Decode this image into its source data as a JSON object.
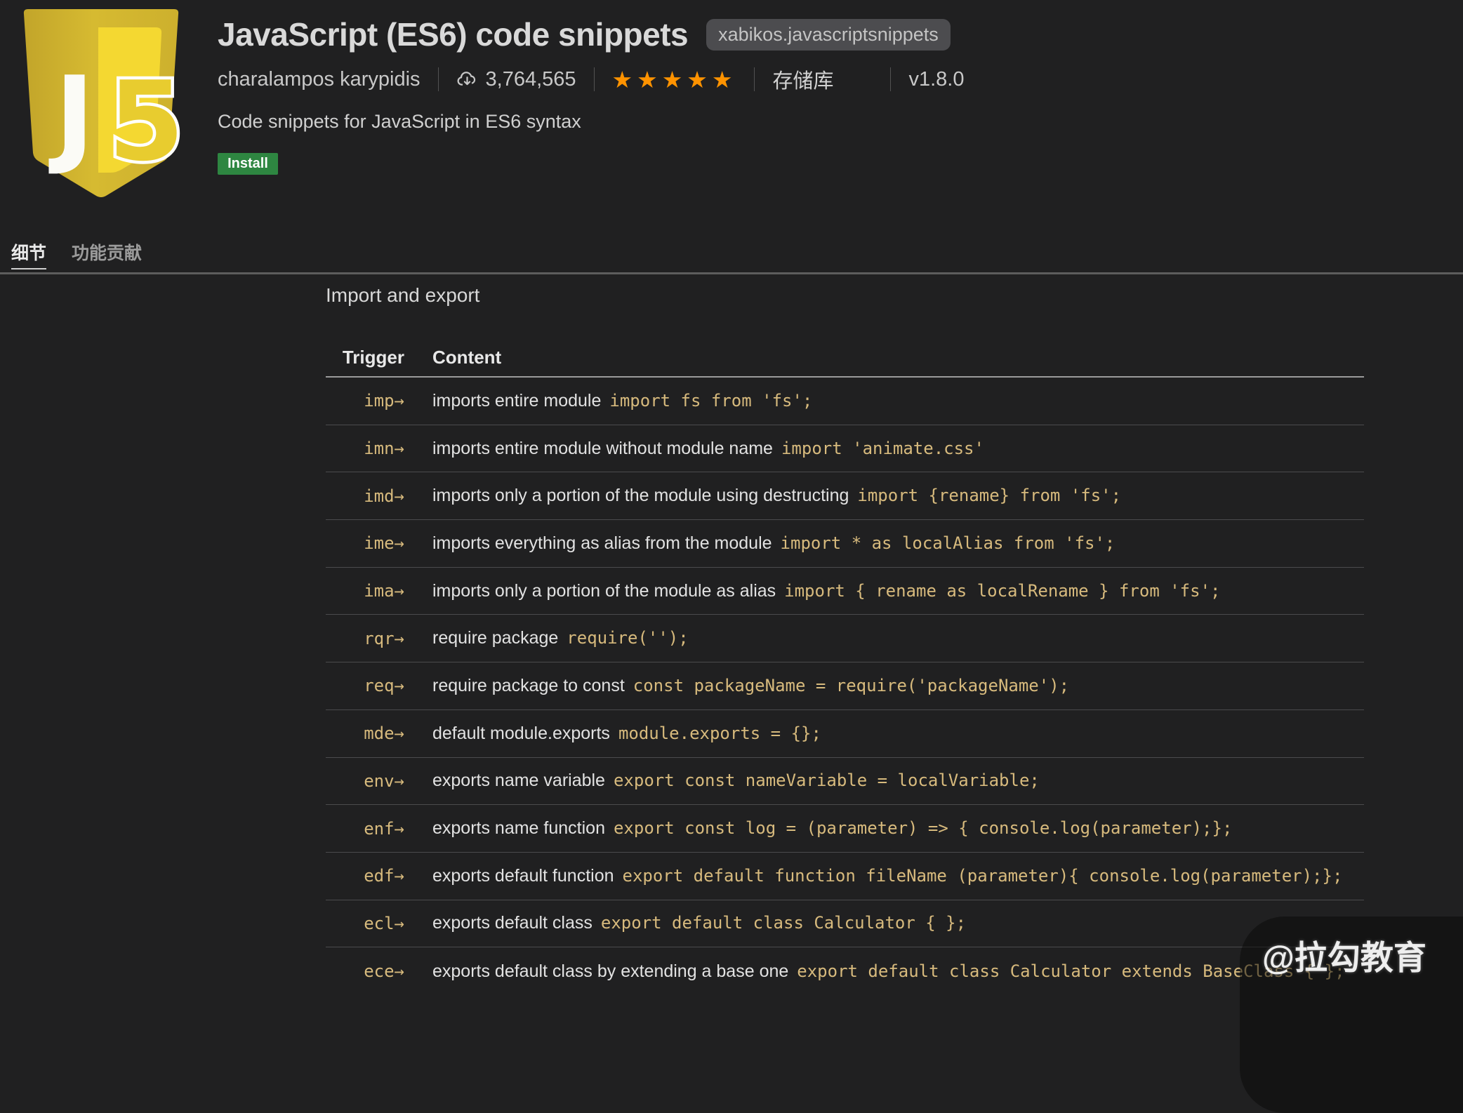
{
  "colors": {
    "page_bg": "#202021",
    "code_gold": "#d7ba7d",
    "star_orange": "#ff9300",
    "install_green": "#2e8641",
    "badge_bg": "#4c4c4f",
    "row_divider": "#4b4b4d",
    "header_underline": "#9b9b9b"
  },
  "header": {
    "title": "JavaScript (ES6) code snippets",
    "extension_id": "xabikos.javascriptsnippets",
    "publisher": "charalampos karypidis",
    "installs": "3,764,565",
    "rating_stars": "★★★★★",
    "repository_label": "存储库",
    "version": "v1.8.0",
    "description": "Code snippets for JavaScript in ES6 syntax",
    "install_label": "Install"
  },
  "tabs": [
    {
      "label": "细节"
    },
    {
      "label": "功能贡献"
    }
  ],
  "section": {
    "title": "Import and export",
    "table": {
      "columns": [
        "Trigger",
        "Content"
      ],
      "rows": [
        {
          "trigger": "imp→",
          "description": "imports entire module",
          "code": "import fs from 'fs';"
        },
        {
          "trigger": "imn→",
          "description": "imports entire module without module name",
          "code": "import 'animate.css'"
        },
        {
          "trigger": "imd→",
          "description": "imports only a portion of the module using destructing",
          "code": "import {rename} from 'fs';"
        },
        {
          "trigger": "ime→",
          "description": "imports everything as alias from the module",
          "code": "import * as localAlias from 'fs';"
        },
        {
          "trigger": "ima→",
          "description": "imports only a portion of the module as alias",
          "code": "import { rename as localRename } from 'fs';"
        },
        {
          "trigger": "rqr→",
          "description": "require package",
          "code": "require('');"
        },
        {
          "trigger": "req→",
          "description": "require package to const",
          "code": "const packageName = require('packageName');"
        },
        {
          "trigger": "mde→",
          "description": "default module.exports",
          "code": "module.exports = {};"
        },
        {
          "trigger": "env→",
          "description": "exports name variable",
          "code": "export const nameVariable = localVariable;"
        },
        {
          "trigger": "enf→",
          "description": "exports name function",
          "code": "export const log = (parameter) => { console.log(parameter);};"
        },
        {
          "trigger": "edf→",
          "description": "exports default function",
          "code": "export default function fileName (parameter){ console.log(parameter);};"
        },
        {
          "trigger": "ecl→",
          "description": "exports default class",
          "code": "export default class Calculator { };"
        },
        {
          "trigger": "ece→",
          "description": "exports default class by extending a base one",
          "code": "export default class Calculator extends BaseClass { };"
        }
      ]
    }
  },
  "watermark": "@拉勾教育"
}
